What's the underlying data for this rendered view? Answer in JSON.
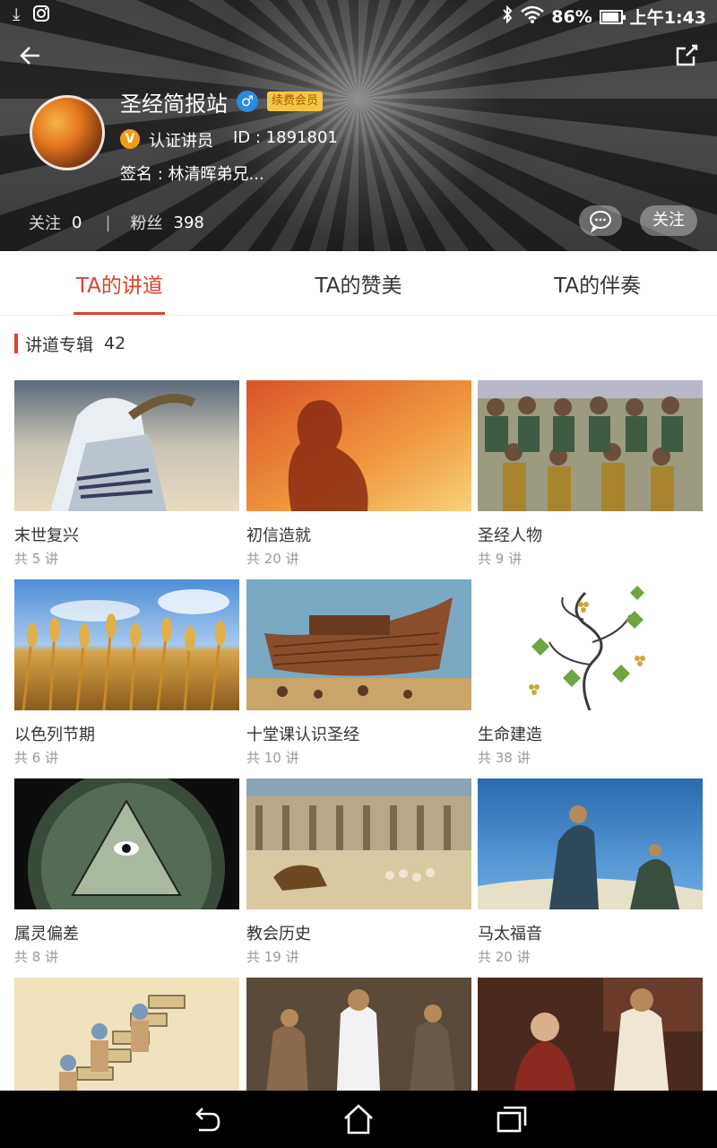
{
  "status_bar": {
    "battery": "86%",
    "time": "上午1:43"
  },
  "profile": {
    "name": "圣经简报站",
    "gender_symbol": "♂",
    "vip_label": "续费会员",
    "v_badge": "V",
    "certification": "认证讲员",
    "id": "ID : 1891801",
    "signature": "签名 : 林清晖弟兄...",
    "following_label": "关注",
    "following_count": "0",
    "separator": "|",
    "followers_label": "粉丝",
    "followers_count": "398",
    "follow_button": "关注"
  },
  "tabs": [
    {
      "label": "TA的讲道"
    },
    {
      "label": "TA的赞美"
    },
    {
      "label": "TA的伴奏"
    }
  ],
  "section": {
    "title": "讲道专辑",
    "count": "42"
  },
  "albums": [
    {
      "title": "末世复兴",
      "count": "共 5 讲"
    },
    {
      "title": "初信造就",
      "count": "共 20 讲"
    },
    {
      "title": "圣经人物",
      "count": "共 9 讲"
    },
    {
      "title": "以色列节期",
      "count": "共 6 讲"
    },
    {
      "title": "十堂课认识圣经",
      "count": "共 10 讲"
    },
    {
      "title": "生命建造",
      "count": "共 38 讲"
    },
    {
      "title": "属灵偏差",
      "count": "共 8 讲"
    },
    {
      "title": "教会历史",
      "count": "共 19 讲"
    },
    {
      "title": "马太福音",
      "count": "共 20 讲"
    },
    {
      "title": "",
      "count": ""
    },
    {
      "title": "",
      "count": ""
    },
    {
      "title": "",
      "count": ""
    }
  ],
  "colors": {
    "accent": "#d9452c",
    "muted": "#999999"
  }
}
